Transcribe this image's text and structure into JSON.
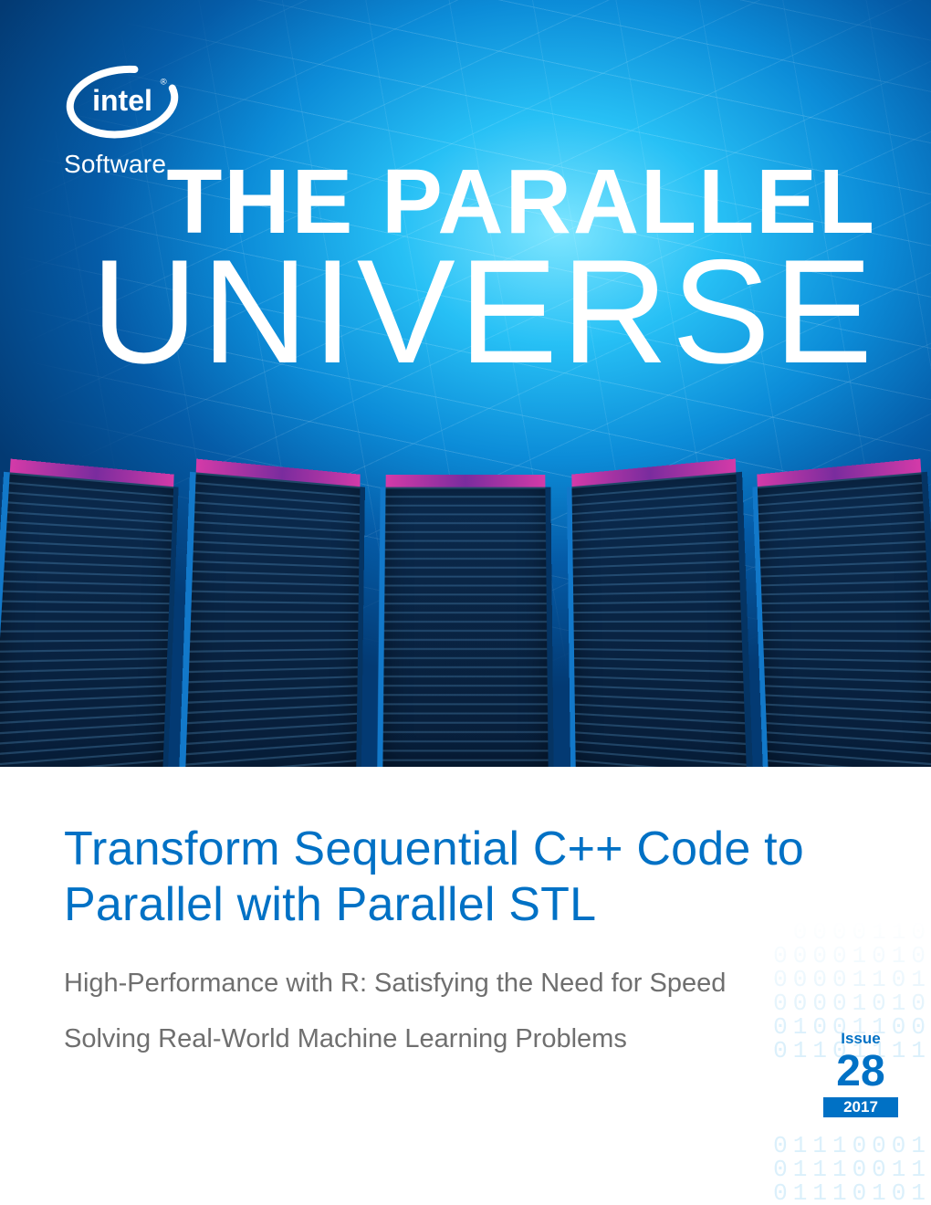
{
  "brand": {
    "name": "intel",
    "subline": "Software"
  },
  "masthead": {
    "line1": "THE PARALLEL",
    "line2": "UNIVERSE"
  },
  "headline": "Transform Sequential C++ Code to Parallel with Parallel STL",
  "sub1": "High-Performance with R: Satisfying the Need for Speed",
  "sub2": "Solving Real-World Machine Learning Problems",
  "issue": {
    "label": "Issue",
    "number": "28",
    "year": "2017"
  },
  "binary": "0000110\n00001010\n00001101\n00001010\n01001100\n01101111\n\n\n\n01110001\n01110011\n01110101",
  "colors": {
    "intel_blue": "#0071c5"
  }
}
